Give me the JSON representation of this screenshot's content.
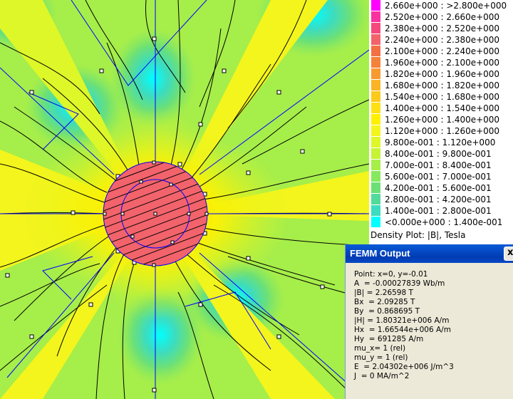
{
  "legend": {
    "rows": [
      {
        "label": "2.660e+000 : >2.800e+000",
        "color": "#ff00ff"
      },
      {
        "label": "2.520e+000 : 2.660e+000",
        "color": "#f8339f"
      },
      {
        "label": "2.380e+000 : 2.520e+000",
        "color": "#f5497e"
      },
      {
        "label": "2.240e+000 : 2.380e+000",
        "color": "#f2636b"
      },
      {
        "label": "2.100e+000 : 2.240e+000",
        "color": "#f37045"
      },
      {
        "label": "1.960e+000 : 2.100e+000",
        "color": "#f5823b"
      },
      {
        "label": "1.820e+000 : 1.960e+000",
        "color": "#f79a30"
      },
      {
        "label": "1.680e+000 : 1.820e+000",
        "color": "#fab427"
      },
      {
        "label": "1.540e+000 : 1.680e+000",
        "color": "#fcca1c"
      },
      {
        "label": "1.400e+000 : 1.540e+000",
        "color": "#ffe014"
      },
      {
        "label": "1.260e+000 : 1.400e+000",
        "color": "#fff000"
      },
      {
        "label": "1.120e+000 : 1.260e+000",
        "color": "#f4f51c"
      },
      {
        "label": "9.800e-001 : 1.120e+000",
        "color": "#def728"
      },
      {
        "label": "8.400e-001 : 9.800e-001",
        "color": "#c6f335"
      },
      {
        "label": "7.000e-001 : 8.400e-001",
        "color": "#a6ee4a"
      },
      {
        "label": "5.600e-001 : 7.000e-001",
        "color": "#86e960"
      },
      {
        "label": "4.200e-001 : 5.600e-001",
        "color": "#6ce077"
      },
      {
        "label": "2.800e-001 : 4.200e-001",
        "color": "#52da9a"
      },
      {
        "label": "1.400e-001 : 2.800e-001",
        "color": "#3cdcc0"
      },
      {
        "label": "<0.000e+000 : 1.400e-001",
        "color": "#00ffff"
      }
    ],
    "caption": "Density Plot: |B|, Tesla"
  },
  "output_window": {
    "title": "FEMM Output",
    "close_label": "x",
    "lines": [
      "Point: x=0, y=-0.01",
      "A  = -0.00027839 Wb/m",
      "|B| = 2.26598 T",
      "Bx  = 2.09285 T",
      "By  = 0.868695 T",
      "|H| = 1.80321e+006 A/m",
      "Hx  = 1.66544e+006 A/m",
      "Hy  = 691285 A/m",
      "mu_x= 1 (rel)",
      "mu_y = 1 (rel)",
      "E  = 2.04302e+006 J/m^3",
      "J  = 0 MA/m^2"
    ]
  },
  "colors": {
    "background_field": "#c6f335",
    "center_disk": "#f2636b",
    "contour_line": "#000000",
    "mesh_line": "#0000ff"
  }
}
